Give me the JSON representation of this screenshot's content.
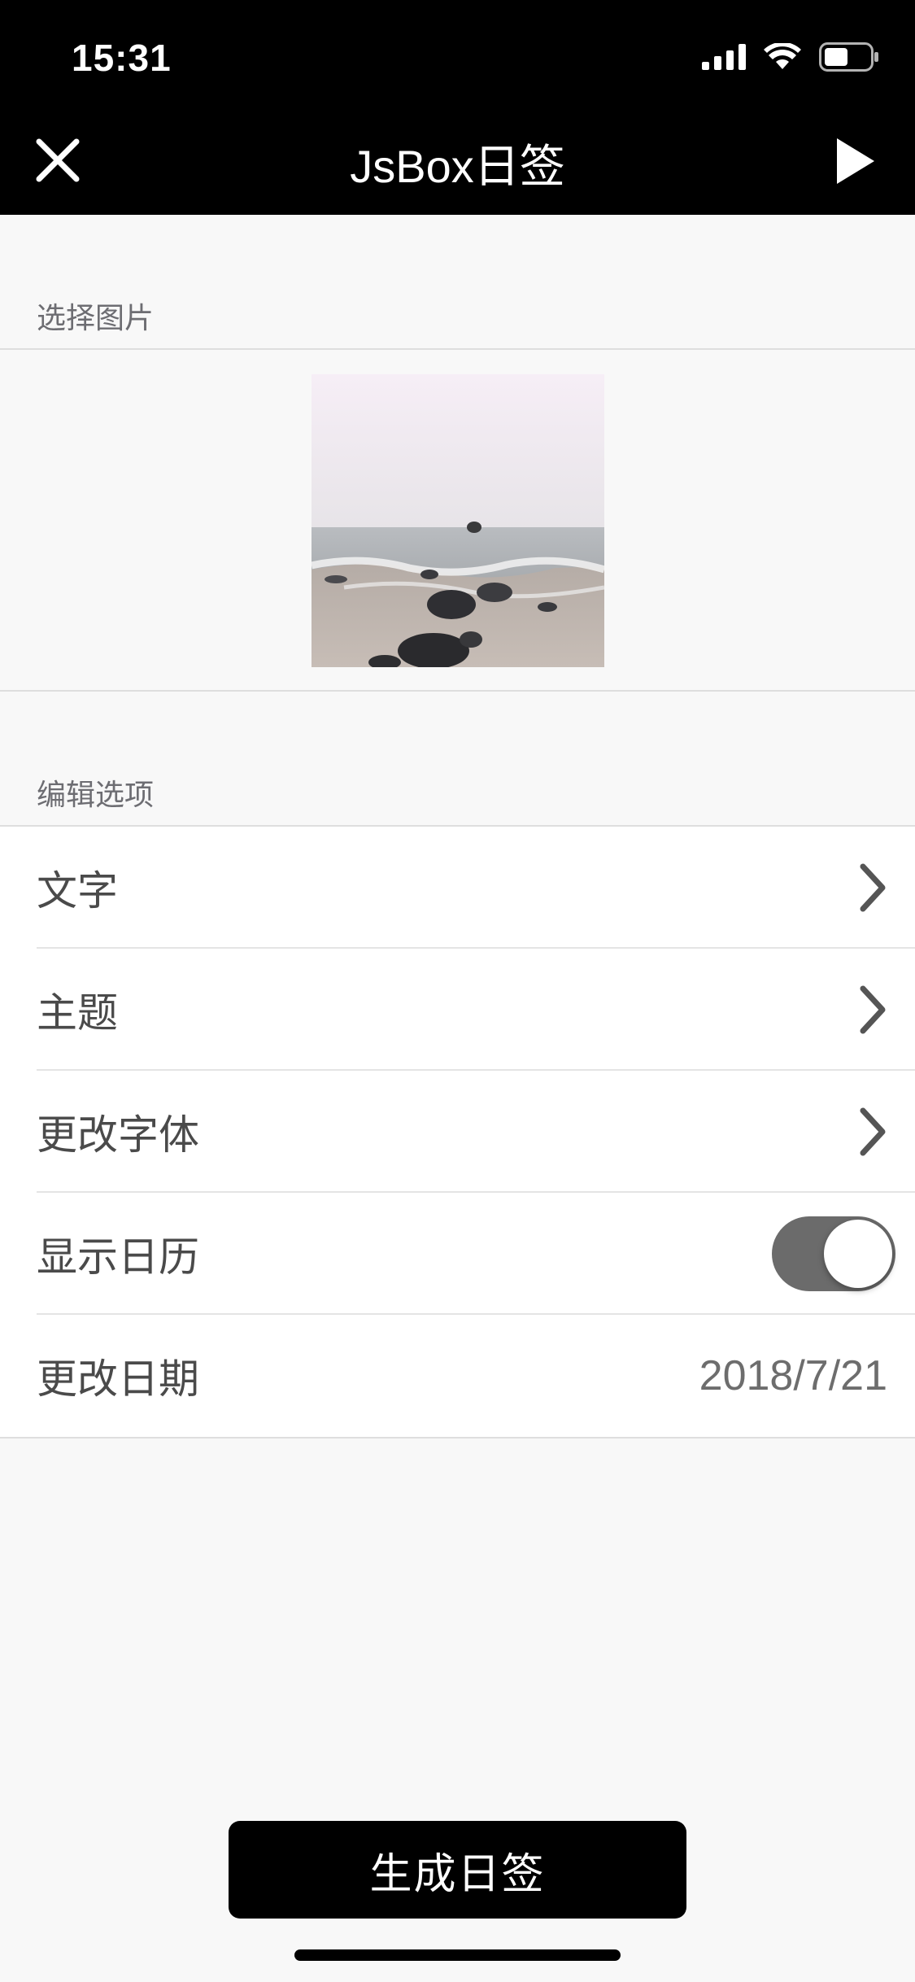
{
  "status_bar": {
    "time": "15:31",
    "icons": [
      "signal-icon",
      "wifi-icon",
      "battery-icon"
    ],
    "battery_level": 0.5
  },
  "nav": {
    "title": "JsBox日签",
    "left_icon": "close-icon",
    "right_icon": "play-icon"
  },
  "image_section": {
    "header": "选择图片",
    "thumbnail": "seascape-rocks-image"
  },
  "options_section": {
    "header": "编辑选项",
    "items": [
      {
        "label": "文字",
        "accessory": "chevron-right-icon"
      },
      {
        "label": "主题",
        "accessory": "chevron-right-icon"
      },
      {
        "label": "更改字体",
        "accessory": "chevron-right-icon"
      },
      {
        "label": "显示日历",
        "accessory": "toggle",
        "toggle_on": true
      },
      {
        "label": "更改日期",
        "value": "2018/7/21"
      }
    ]
  },
  "generate_button": {
    "label": "生成日签"
  },
  "colors": {
    "bar": "#000000",
    "background": "#f8f8f8",
    "toggle_track": "#6b6b6b",
    "button": "#000000"
  }
}
